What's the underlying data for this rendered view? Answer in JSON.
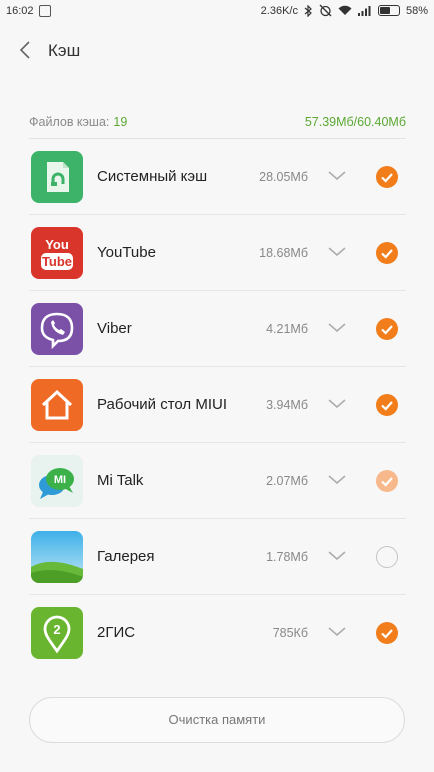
{
  "status_bar": {
    "time": "16:02",
    "speed": "2.36K/c",
    "battery": "58%",
    "battery_level": 0.58
  },
  "header": {
    "title": "Кэш"
  },
  "summary": {
    "label": "Файлов кэша:",
    "count": "19",
    "total": "57.39Мб/60.40Мб"
  },
  "apps": [
    {
      "name": "Системный кэш",
      "size": "28.05Мб",
      "icon": "system-cache-icon",
      "checked": "on"
    },
    {
      "name": "YouTube",
      "size": "18.68Мб",
      "icon": "youtube-icon",
      "checked": "on"
    },
    {
      "name": "Viber",
      "size": "4.21Мб",
      "icon": "viber-icon",
      "checked": "on"
    },
    {
      "name": "Рабочий стол MIUI",
      "size": "3.94Мб",
      "icon": "miui-home-icon",
      "checked": "on"
    },
    {
      "name": "Mi Talk",
      "size": "2.07Мб",
      "icon": "mi-talk-icon",
      "checked": "light"
    },
    {
      "name": "Галерея",
      "size": "1.78Мб",
      "icon": "gallery-icon",
      "checked": "off"
    },
    {
      "name": "2ГИС",
      "size": "785Кб",
      "icon": "2gis-icon",
      "checked": "on"
    }
  ],
  "youtube_icon": {
    "line1": "You",
    "line2": "Tube"
  },
  "mitalk_icon": {
    "text": "MI"
  },
  "twogis_icon": {
    "text": "2"
  },
  "footer": {
    "clear_button": "Очистка памяти"
  },
  "colors": {
    "accent_orange": "#f27d1b",
    "accent_green": "#5aa832",
    "youtube_red": "#d9352b",
    "viber_purple": "#7b51a8",
    "miui_orange": "#ef6a25",
    "twogis_green": "#6ab52f"
  }
}
